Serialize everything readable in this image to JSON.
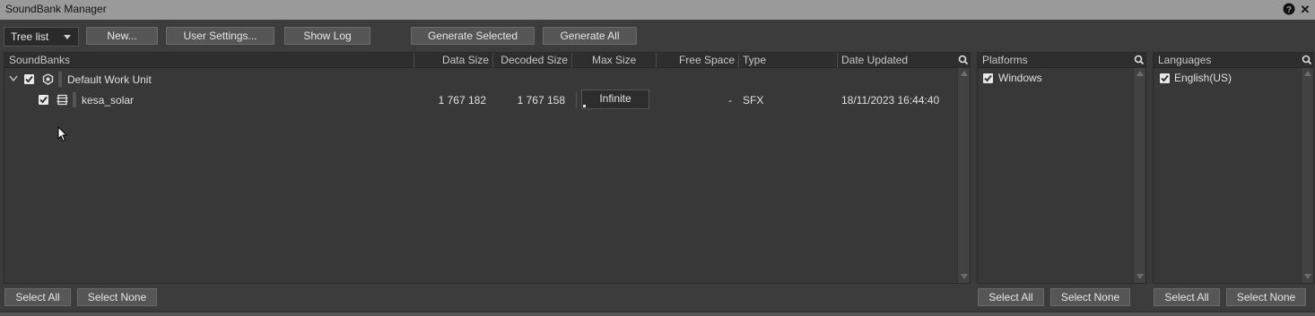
{
  "window": {
    "title": "SoundBank Manager"
  },
  "titlebar_icons": {
    "help": "?",
    "close": "✕"
  },
  "toolbar": {
    "view_select": "Tree list",
    "new_label": "New...",
    "user_settings_label": "User Settings...",
    "show_log_label": "Show Log",
    "generate_selected_label": "Generate Selected",
    "generate_all_label": "Generate All"
  },
  "soundbanks": {
    "columns": [
      "SoundBanks",
      "Data Size",
      "Decoded Size",
      "Max Size",
      "Free Space",
      "Type",
      "Date Updated"
    ],
    "work_unit": {
      "name": "Default Work Unit",
      "checked": true
    },
    "rows": [
      {
        "name": "kesa_solar",
        "checked": true,
        "data_size": "1 767 182",
        "decoded_size": "1 767 158",
        "max_size": "Infinite",
        "free_space": "-",
        "type": "SFX",
        "date_updated": "18/11/2023 16:44:40"
      }
    ],
    "select_all_label": "Select All",
    "select_none_label": "Select None"
  },
  "platforms": {
    "header": "Platforms",
    "items": [
      {
        "label": "Windows",
        "checked": true
      }
    ],
    "select_all_label": "Select All",
    "select_none_label": "Select None"
  },
  "languages": {
    "header": "Languages",
    "items": [
      {
        "label": "English(US)",
        "checked": true
      }
    ],
    "select_all_label": "Select All",
    "select_none_label": "Select None"
  },
  "colors": {
    "titlebar": "#9a9a9a",
    "panel_bg": "#383838",
    "button_bg": "#565656",
    "checkbox": "#e8e8e8"
  }
}
